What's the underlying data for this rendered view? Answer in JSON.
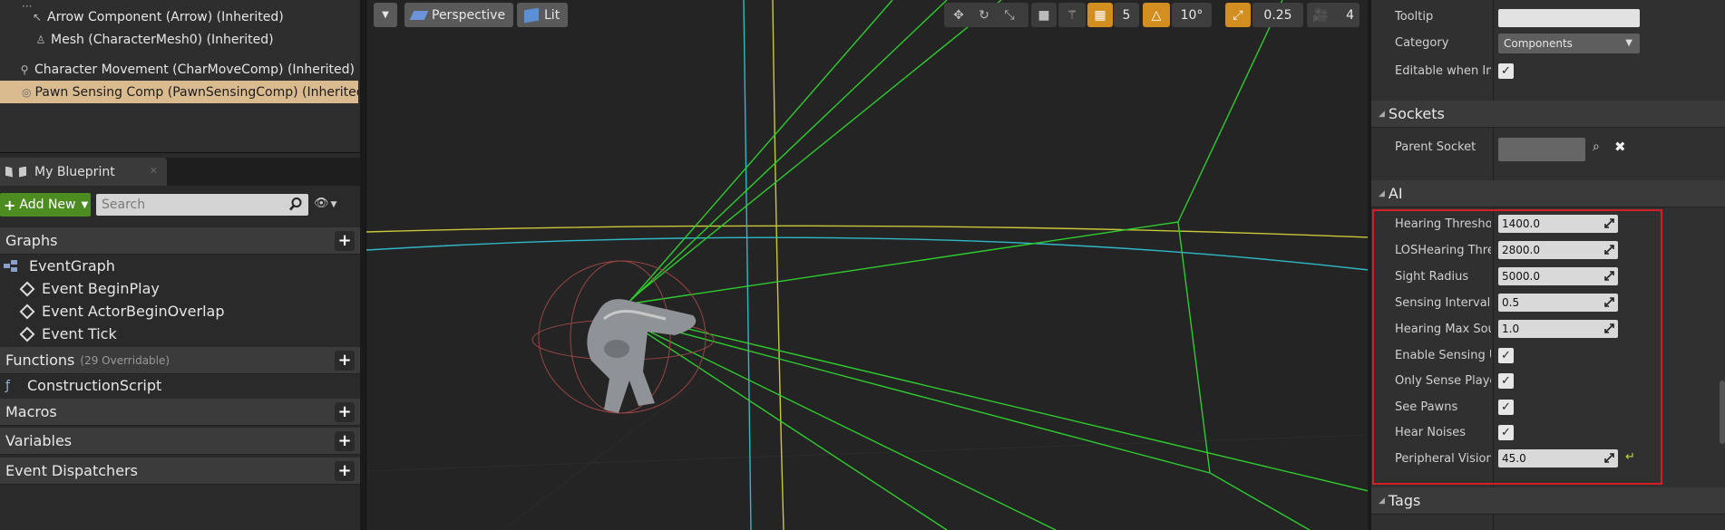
{
  "components": {
    "items": [
      {
        "label": "Arrow Component (Arrow) (Inherited)",
        "icon": "arrow-icon"
      },
      {
        "label": "Mesh (CharacterMesh0) (Inherited)",
        "icon": "mesh-icon"
      },
      {
        "label": "Character Movement (CharMoveComp) (Inherited)",
        "icon": "movement-icon"
      },
      {
        "label": "Pawn Sensing Comp (PawnSensingComp) (Inherited)",
        "icon": "sensing-icon"
      }
    ]
  },
  "my_blueprint": {
    "tab_label": "My Blueprint",
    "add_new_label": "Add New",
    "search_placeholder": "Search",
    "sections": {
      "graphs": "Graphs",
      "functions": "Functions",
      "functions_count": "(29 Overridable)",
      "macros": "Macros",
      "variables": "Variables",
      "event_dispatchers": "Event Dispatchers"
    },
    "event_graph": "EventGraph",
    "events": [
      "Event BeginPlay",
      "Event ActorBeginOverlap",
      "Event Tick"
    ],
    "construction_script": "ConstructionScript"
  },
  "viewport": {
    "perspective_label": "Perspective",
    "lit_label": "Lit",
    "grid_snap": "5",
    "rotation_snap": "10°",
    "scale_snap": "0.25",
    "camera_speed": "4"
  },
  "details": {
    "tooltip_label": "Tooltip",
    "category_label": "Category",
    "category_value": "Components",
    "editable_label": "Editable when Inhe",
    "sockets_header": "Sockets",
    "parent_socket_label": "Parent Socket",
    "ai_header": "AI",
    "ai_props": {
      "hearing_threshold_label": "Hearing Threshold",
      "hearing_threshold_value": "1400.0",
      "los_hearing_label": "LOSHearing Thresh",
      "los_hearing_value": "2800.0",
      "sight_radius_label": "Sight Radius",
      "sight_radius_value": "5000.0",
      "sensing_interval_label": "Sensing Interval",
      "sensing_interval_value": "0.5",
      "hearing_max_label": "Hearing Max Sound",
      "hearing_max_value": "1.0",
      "enable_sensing_label": "Enable Sensing Upd",
      "only_sense_label": "Only Sense Players",
      "see_pawns_label": "See Pawns",
      "hear_noises_label": "Hear Noises",
      "peripheral_label": "Peripheral Vision A",
      "peripheral_value": "45.0"
    },
    "tags_header": "Tags"
  },
  "colors": {
    "selected_row": "#d9bb8f",
    "add_new": "#4c8c20",
    "highlight_box": "#d61f24",
    "snap_active": "#d28e1e"
  }
}
